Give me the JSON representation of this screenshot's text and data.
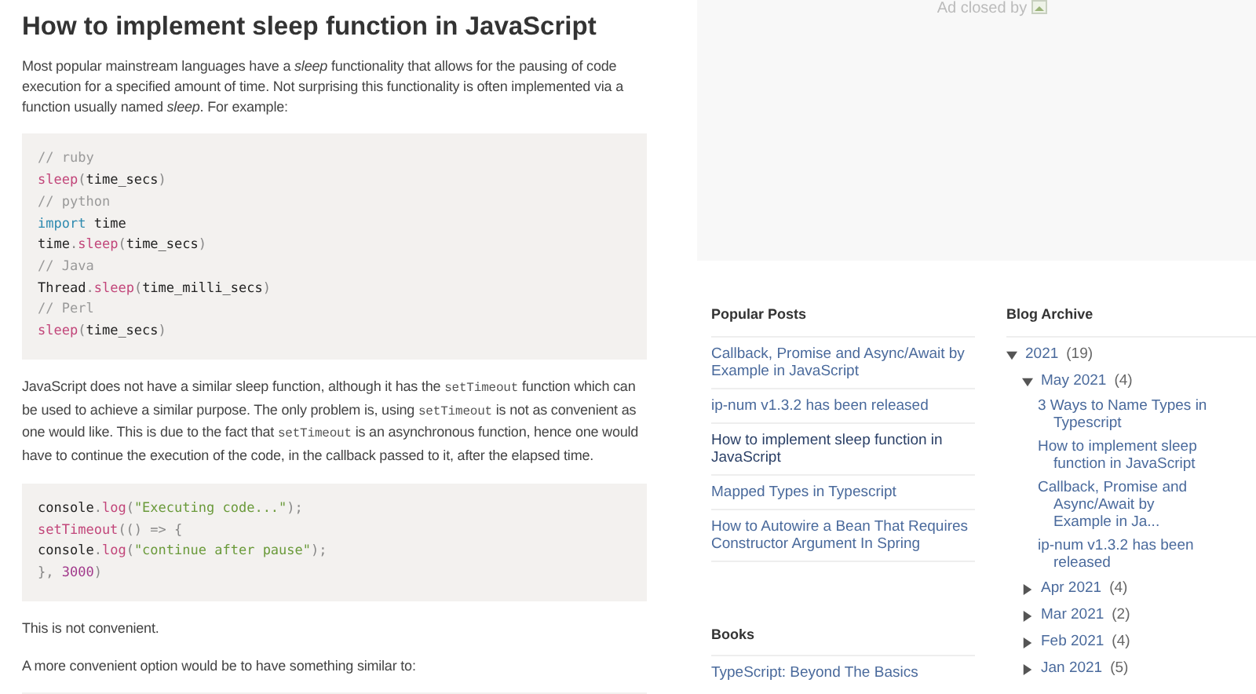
{
  "post": {
    "title": "How to implement sleep function in JavaScript",
    "blocks": [
      {
        "kind": "paragraph",
        "segments": [
          {
            "kind": "text",
            "text": "Most popular mainstream languages have a "
          },
          {
            "kind": "em",
            "text": "sleep"
          },
          {
            "kind": "text",
            "text": " functionality that allows for the pausing of code execution for a specified amount of time. Not surprising this functionality is often implemented via a function usually named "
          },
          {
            "kind": "em",
            "text": "sleep"
          },
          {
            "kind": "text",
            "text": ". For example:"
          }
        ]
      },
      {
        "kind": "code",
        "lines": [
          [
            {
              "kind": "comment",
              "text": "// ruby"
            }
          ],
          [
            {
              "kind": "fn",
              "text": "sleep"
            },
            {
              "kind": "punct",
              "text": "("
            },
            {
              "kind": "plain",
              "text": "time_secs"
            },
            {
              "kind": "punct",
              "text": ")"
            }
          ],
          [
            {
              "kind": "comment",
              "text": "// python"
            }
          ],
          [
            {
              "kind": "keyword",
              "text": "import"
            },
            {
              "kind": "plain",
              "text": " time"
            }
          ],
          [
            {
              "kind": "plain",
              "text": "time"
            },
            {
              "kind": "punct",
              "text": "."
            },
            {
              "kind": "fn",
              "text": "sleep"
            },
            {
              "kind": "punct",
              "text": "("
            },
            {
              "kind": "plain",
              "text": "time_secs"
            },
            {
              "kind": "punct",
              "text": ")"
            }
          ],
          [
            {
              "kind": "comment",
              "text": "// Java"
            }
          ],
          [
            {
              "kind": "plain",
              "text": "Thread"
            },
            {
              "kind": "punct",
              "text": "."
            },
            {
              "kind": "fn",
              "text": "sleep"
            },
            {
              "kind": "punct",
              "text": "("
            },
            {
              "kind": "plain",
              "text": "time_milli_secs"
            },
            {
              "kind": "punct",
              "text": ")"
            }
          ],
          [
            {
              "kind": "comment",
              "text": "// Perl"
            }
          ],
          [
            {
              "kind": "fn",
              "text": "sleep"
            },
            {
              "kind": "punct",
              "text": "("
            },
            {
              "kind": "plain",
              "text": "time_secs"
            },
            {
              "kind": "punct",
              "text": ")"
            }
          ]
        ]
      },
      {
        "kind": "paragraph",
        "segments": [
          {
            "kind": "text",
            "text": "JavaScript does not have a similar sleep function, although it has the "
          },
          {
            "kind": "code",
            "text": "setTimeout"
          },
          {
            "kind": "text",
            "text": " function which can be used to achieve a similar purpose. The only problem is, using "
          },
          {
            "kind": "code",
            "text": "setTimeout"
          },
          {
            "kind": "text",
            "text": " is not as convenient as one would like. This is due to the fact that "
          },
          {
            "kind": "code",
            "text": "setTimeout"
          },
          {
            "kind": "text",
            "text": " is an asynchronous function, hence one would have to continue the execution of the code, in the callback passed to it, after the elapsed time."
          }
        ]
      },
      {
        "kind": "code",
        "lines": [
          [
            {
              "kind": "plain",
              "text": "console"
            },
            {
              "kind": "punct",
              "text": "."
            },
            {
              "kind": "fn",
              "text": "log"
            },
            {
              "kind": "punct",
              "text": "("
            },
            {
              "kind": "string",
              "text": "\"Executing code...\""
            },
            {
              "kind": "punct",
              "text": ");"
            }
          ],
          [
            {
              "kind": "fn",
              "text": "setTimeout"
            },
            {
              "kind": "punct",
              "text": "(() => {"
            }
          ],
          [
            {
              "kind": "plain",
              "text": "console"
            },
            {
              "kind": "punct",
              "text": "."
            },
            {
              "kind": "fn",
              "text": "log"
            },
            {
              "kind": "punct",
              "text": "("
            },
            {
              "kind": "string",
              "text": "\"continue after pause\""
            },
            {
              "kind": "punct",
              "text": ");"
            }
          ],
          [
            {
              "kind": "punct",
              "text": "}, "
            },
            {
              "kind": "number",
              "text": "3000"
            },
            {
              "kind": "punct",
              "text": ")"
            }
          ]
        ]
      },
      {
        "kind": "paragraph",
        "segments": [
          {
            "kind": "text",
            "text": "This is not convenient."
          }
        ]
      },
      {
        "kind": "paragraph",
        "segments": [
          {
            "kind": "text",
            "text": "A more convenient option would be to have something similar to:"
          }
        ]
      },
      {
        "kind": "code"
      }
    ]
  },
  "ad": {
    "text": "Ad closed by"
  },
  "popular_posts": {
    "title": "Popular Posts",
    "items": [
      {
        "label": "Callback, Promise and Async/Await by Example in JavaScript",
        "current": false
      },
      {
        "label": "ip-num v1.3.2 has been released",
        "current": false
      },
      {
        "label": "How to implement sleep function in JavaScript",
        "current": true
      },
      {
        "label": "Mapped Types in Typescript",
        "current": false
      },
      {
        "label": "How to Autowire a Bean That Requires Constructor Argument In Spring",
        "current": false
      }
    ]
  },
  "books": {
    "title": "Books",
    "items": [
      {
        "label": "TypeScript: Beyond The Basics"
      }
    ]
  },
  "blog_archive": {
    "title": "Blog Archive",
    "items": [
      {
        "label": "2021",
        "count": "(19)",
        "expanded": true,
        "children": [
          {
            "label": "May 2021",
            "count": "(4)",
            "expanded": true,
            "posts": [
              "3 Ways to Name Types in Typescript",
              "How to implement sleep function in JavaScript",
              "Callback, Promise and Async/Await by Example in Ja...",
              "ip-num v1.3.2 has been released"
            ]
          },
          {
            "label": "Apr 2021",
            "count": "(4)",
            "expanded": false
          },
          {
            "label": "Mar 2021",
            "count": "(2)",
            "expanded": false
          },
          {
            "label": "Feb 2021",
            "count": "(4)",
            "expanded": false
          },
          {
            "label": "Jan 2021",
            "count": "(5)",
            "expanded": false
          }
        ]
      }
    ]
  }
}
